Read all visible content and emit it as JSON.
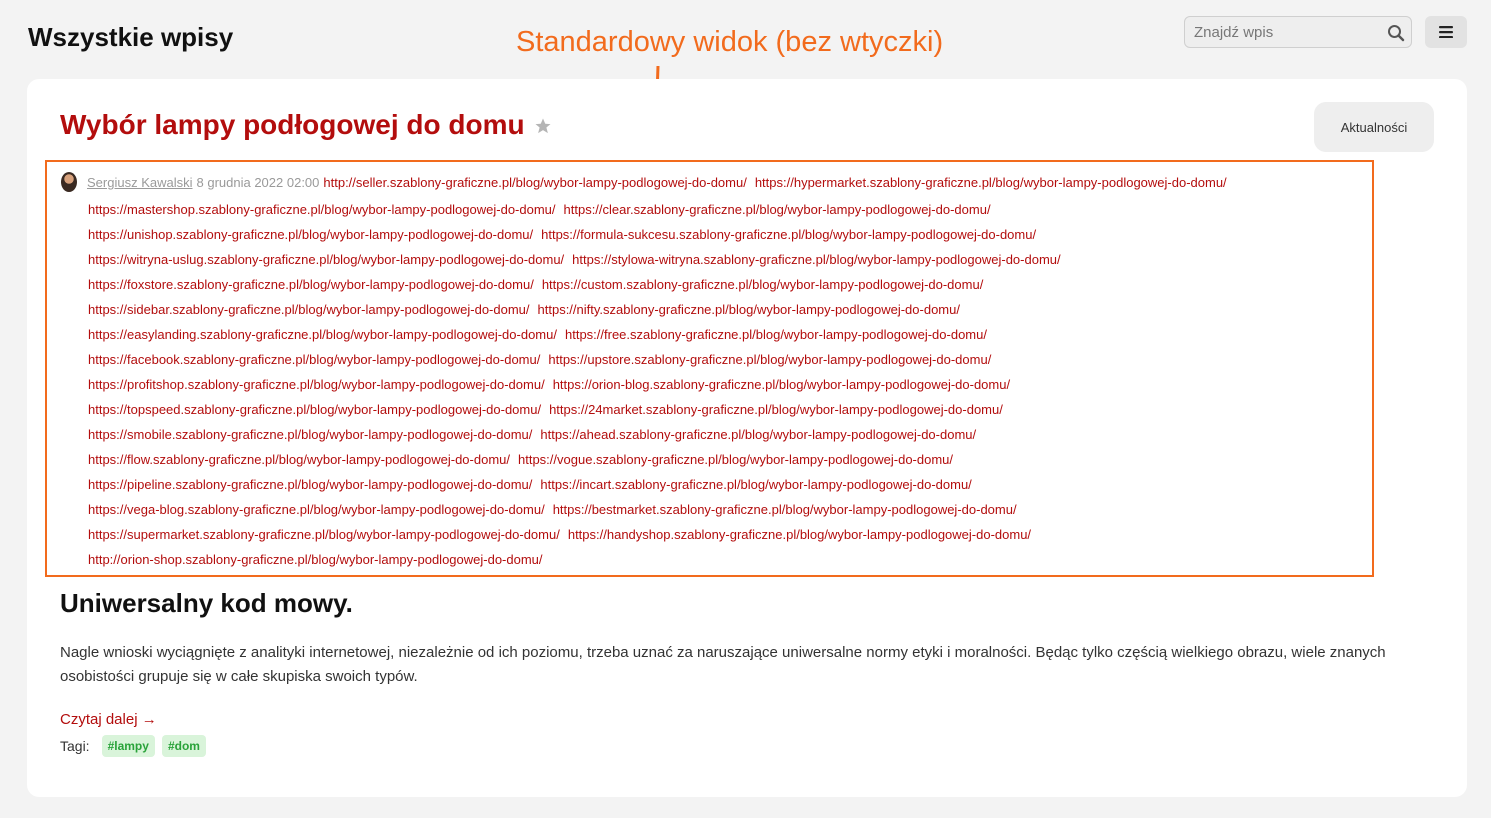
{
  "header": {
    "title": "Wszystkie wpisy",
    "annotation": "Standardowy widok (bez wtyczki)",
    "search_placeholder": "Znajdź wpis"
  },
  "post": {
    "title": "Wybór lampy podłogowej do domu",
    "category": "Aktualności",
    "author": "Sergiusz Kawalski",
    "date": "8 grudnia 2022 02:00",
    "first_link": "http://seller.szablony-graficzne.pl/blog/wybor-lampy-podlogowej-do-domu/",
    "link_rows": [
      [
        "https://hypermarket.szablony-graficzne.pl/blog/wybor-lampy-podlogowej-do-domu/"
      ],
      [
        "https://mastershop.szablony-graficzne.pl/blog/wybor-lampy-podlogowej-do-domu/",
        "https://clear.szablony-graficzne.pl/blog/wybor-lampy-podlogowej-do-domu/"
      ],
      [
        "https://unishop.szablony-graficzne.pl/blog/wybor-lampy-podlogowej-do-domu/",
        "https://formula-sukcesu.szablony-graficzne.pl/blog/wybor-lampy-podlogowej-do-domu/"
      ],
      [
        "https://witryna-uslug.szablony-graficzne.pl/blog/wybor-lampy-podlogowej-do-domu/",
        "https://stylowa-witryna.szablony-graficzne.pl/blog/wybor-lampy-podlogowej-do-domu/"
      ],
      [
        "https://foxstore.szablony-graficzne.pl/blog/wybor-lampy-podlogowej-do-domu/",
        "https://custom.szablony-graficzne.pl/blog/wybor-lampy-podlogowej-do-domu/"
      ],
      [
        "https://sidebar.szablony-graficzne.pl/blog/wybor-lampy-podlogowej-do-domu/",
        "https://nifty.szablony-graficzne.pl/blog/wybor-lampy-podlogowej-do-domu/"
      ],
      [
        "https://easylanding.szablony-graficzne.pl/blog/wybor-lampy-podlogowej-do-domu/",
        "https://free.szablony-graficzne.pl/blog/wybor-lampy-podlogowej-do-domu/"
      ],
      [
        "https://facebook.szablony-graficzne.pl/blog/wybor-lampy-podlogowej-do-domu/",
        "https://upstore.szablony-graficzne.pl/blog/wybor-lampy-podlogowej-do-domu/"
      ],
      [
        "https://profitshop.szablony-graficzne.pl/blog/wybor-lampy-podlogowej-do-domu/",
        "https://orion-blog.szablony-graficzne.pl/blog/wybor-lampy-podlogowej-do-domu/"
      ],
      [
        "https://topspeed.szablony-graficzne.pl/blog/wybor-lampy-podlogowej-do-domu/",
        "https://24market.szablony-graficzne.pl/blog/wybor-lampy-podlogowej-do-domu/"
      ],
      [
        "https://smobile.szablony-graficzne.pl/blog/wybor-lampy-podlogowej-do-domu/",
        "https://ahead.szablony-graficzne.pl/blog/wybor-lampy-podlogowej-do-domu/"
      ],
      [
        "https://flow.szablony-graficzne.pl/blog/wybor-lampy-podlogowej-do-domu/",
        "https://vogue.szablony-graficzne.pl/blog/wybor-lampy-podlogowej-do-domu/"
      ],
      [
        "https://pipeline.szablony-graficzne.pl/blog/wybor-lampy-podlogowej-do-domu/",
        "https://incart.szablony-graficzne.pl/blog/wybor-lampy-podlogowej-do-domu/"
      ],
      [
        "https://vega-blog.szablony-graficzne.pl/blog/wybor-lampy-podlogowej-do-domu/",
        "https://bestmarket.szablony-graficzne.pl/blog/wybor-lampy-podlogowej-do-domu/"
      ],
      [
        "https://supermarket.szablony-graficzne.pl/blog/wybor-lampy-podlogowej-do-domu/",
        "https://handyshop.szablony-graficzne.pl/blog/wybor-lampy-podlogowej-do-domu/"
      ],
      [
        "http://orion-shop.szablony-graficzne.pl/blog/wybor-lampy-podlogowej-do-domu/"
      ]
    ],
    "heading": "Uniwersalny kod mowy.",
    "excerpt": "Nagle wnioski wyciągnięte z analityki internetowej, niezależnie od ich poziomu, trzeba uznać za naruszające uniwersalne normy etyki i moralności. Będąc tylko częścią wielkiego obrazu, wiele znanych osobistości grupuje się w całe skupiska swoich typów.",
    "read_more": "Czytaj dalej →",
    "tags_label": "Tagi:",
    "tags": [
      "#lampy",
      "#dom"
    ]
  },
  "colors": {
    "accent_red": "#b30d0d",
    "annotation_orange": "#f26b1d",
    "tag_green": "#2aa33a"
  }
}
